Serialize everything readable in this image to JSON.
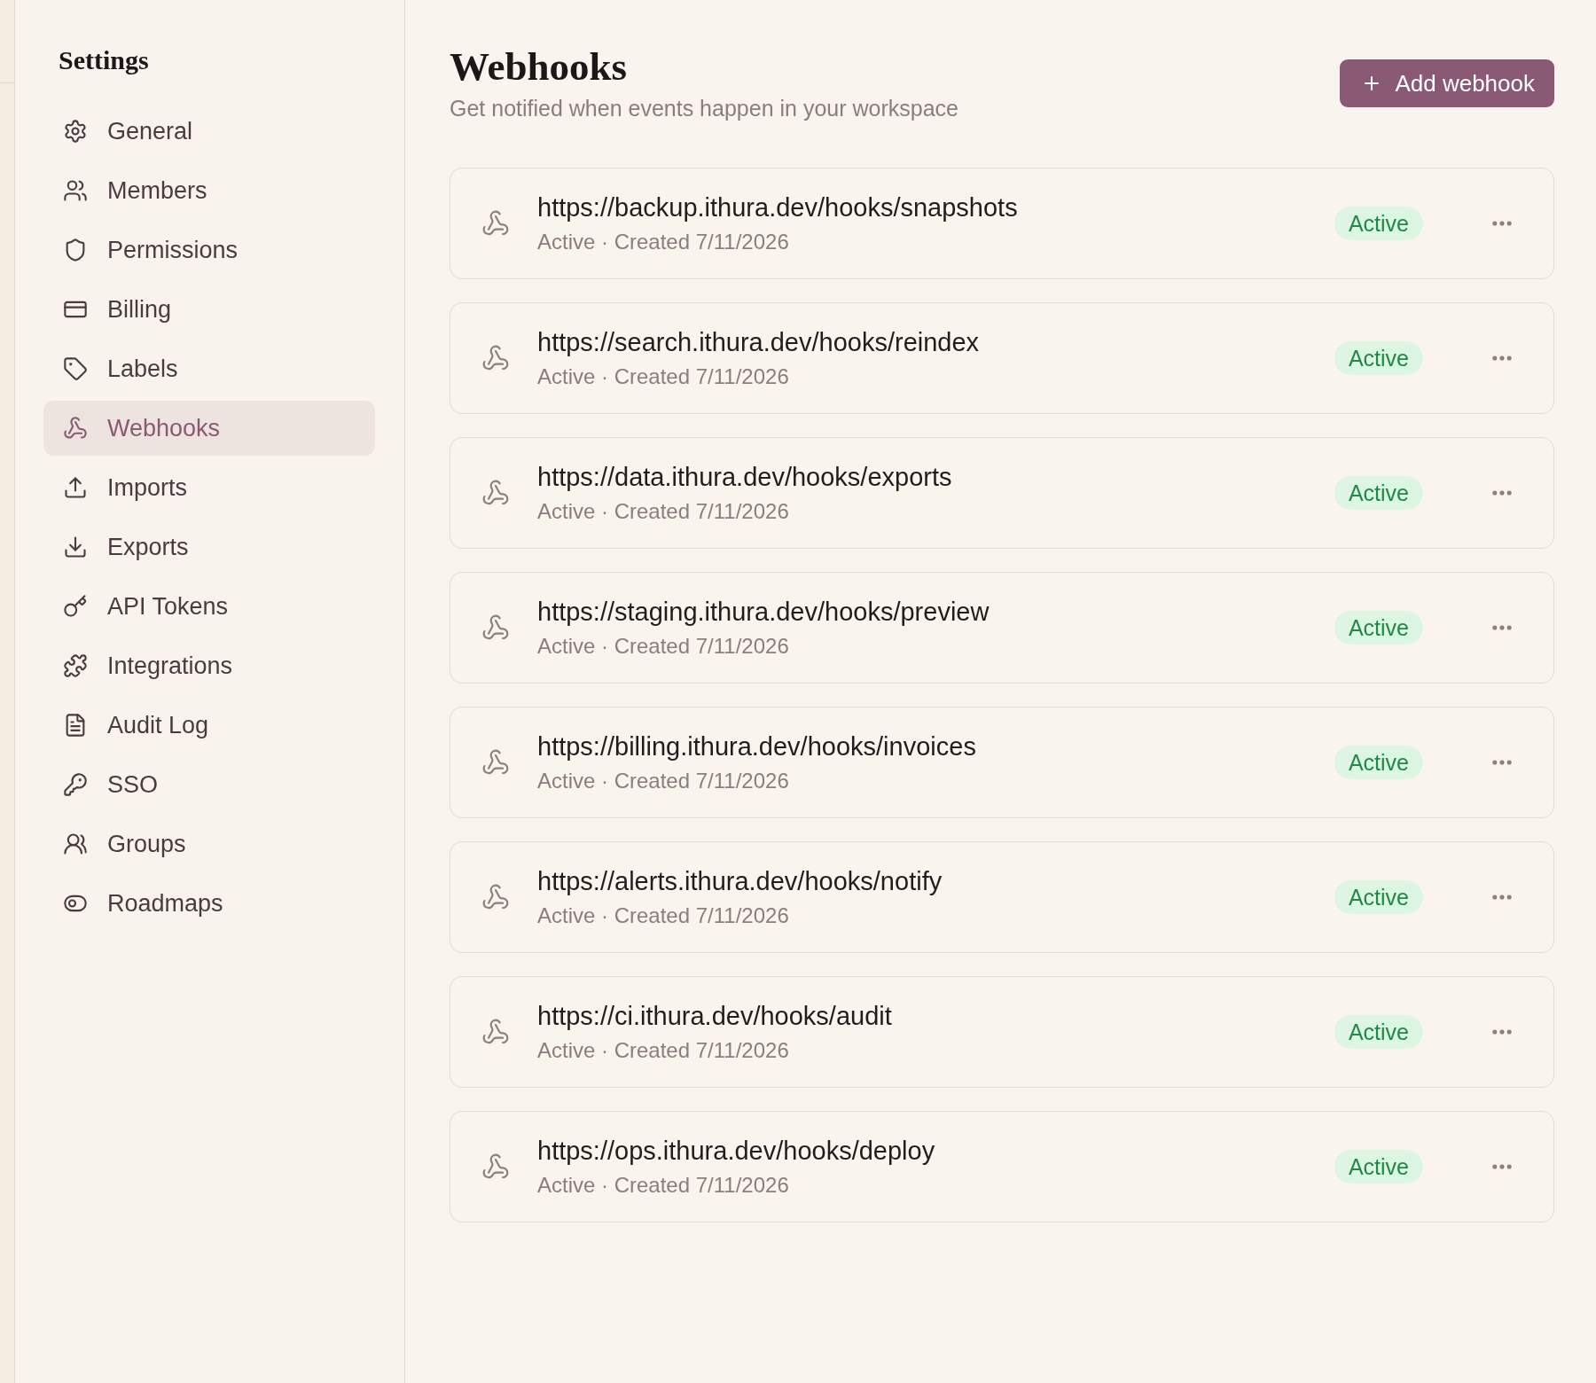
{
  "sidebar": {
    "title": "Settings",
    "items": [
      {
        "label": "General",
        "selected": false
      },
      {
        "label": "Members",
        "selected": false
      },
      {
        "label": "Permissions",
        "selected": false
      },
      {
        "label": "Billing",
        "selected": false
      },
      {
        "label": "Labels",
        "selected": false
      },
      {
        "label": "Webhooks",
        "selected": true
      },
      {
        "label": "Imports",
        "selected": false
      },
      {
        "label": "Exports",
        "selected": false
      },
      {
        "label": "API Tokens",
        "selected": false
      },
      {
        "label": "Integrations",
        "selected": false
      },
      {
        "label": "Audit Log",
        "selected": false
      },
      {
        "label": "SSO",
        "selected": false
      },
      {
        "label": "Groups",
        "selected": false
      },
      {
        "label": "Roadmaps",
        "selected": false
      }
    ]
  },
  "header": {
    "title": "Webhooks",
    "subtitle": "Get notified when events happen in your workspace",
    "add_button": "Add webhook"
  },
  "webhooks": [
    {
      "url": "https://backup.ithura.dev/hooks/snapshots",
      "meta": "Active · Created 7/11/2026",
      "badge": "Active"
    },
    {
      "url": "https://search.ithura.dev/hooks/reindex",
      "meta": "Active · Created 7/11/2026",
      "badge": "Active"
    },
    {
      "url": "https://data.ithura.dev/hooks/exports",
      "meta": "Active · Created 7/11/2026",
      "badge": "Active"
    },
    {
      "url": "https://staging.ithura.dev/hooks/preview",
      "meta": "Active · Created 7/11/2026",
      "badge": "Active"
    },
    {
      "url": "https://billing.ithura.dev/hooks/invoices",
      "meta": "Active · Created 7/11/2026",
      "badge": "Active"
    },
    {
      "url": "https://alerts.ithura.dev/hooks/notify",
      "meta": "Active · Created 7/11/2026",
      "badge": "Active"
    },
    {
      "url": "https://ci.ithura.dev/hooks/audit",
      "meta": "Active · Created 7/11/2026",
      "badge": "Active"
    },
    {
      "url": "https://ops.ithura.dev/hooks/deploy",
      "meta": "Active · Created 7/11/2026",
      "badge": "Active"
    }
  ]
}
